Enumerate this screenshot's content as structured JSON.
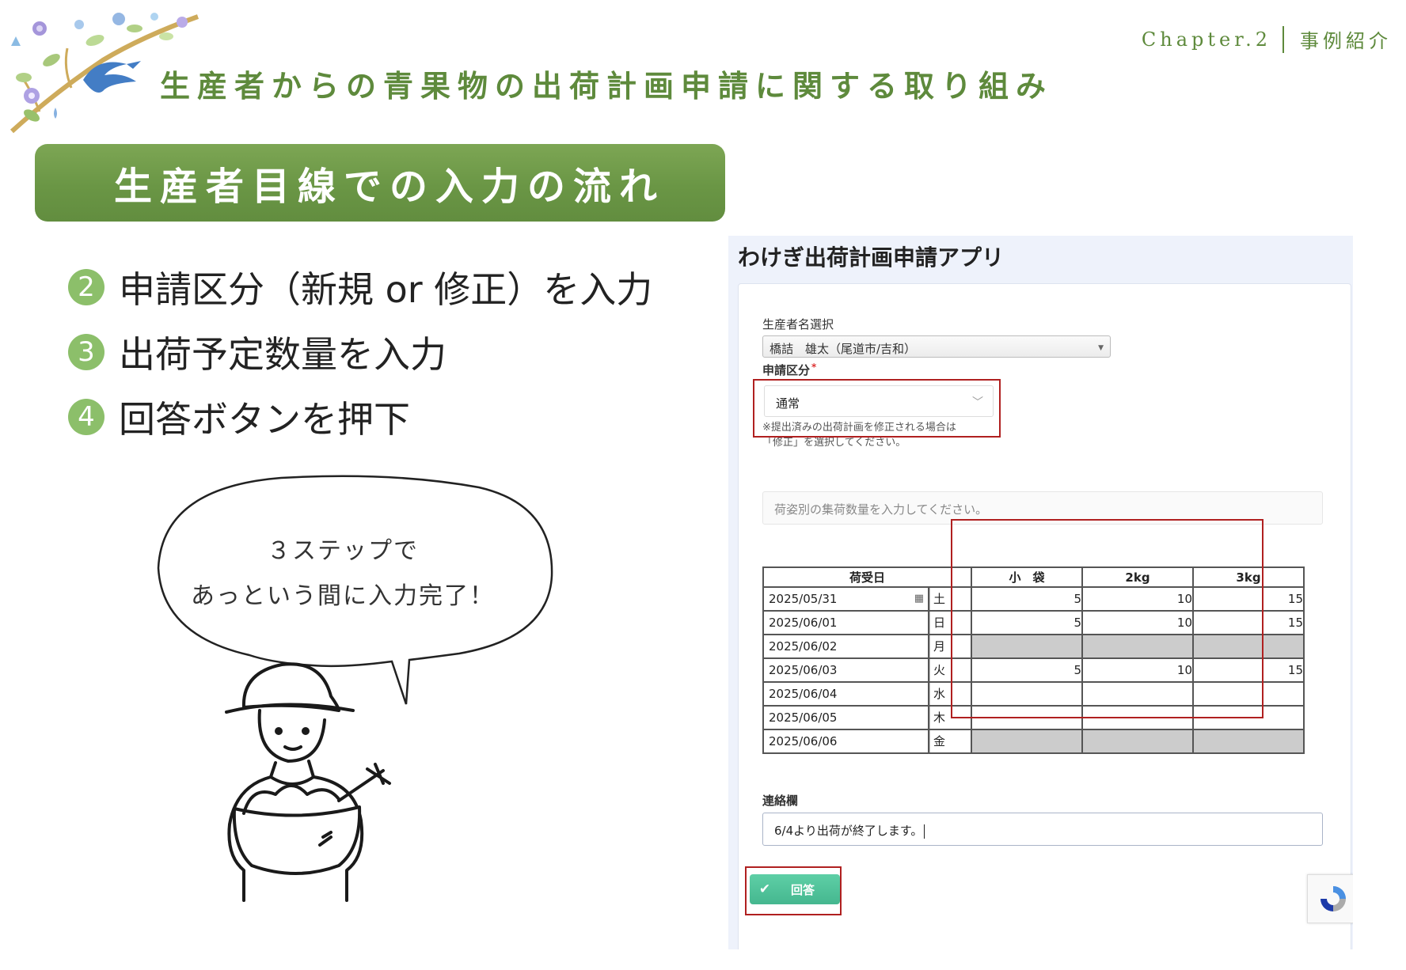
{
  "slide": {
    "chapter": "Chapter.2",
    "section": "事例紹介",
    "title": "生産者からの青果物の出荷計画申請に関する取り組み",
    "banner": "生産者目線での入力の流れ",
    "steps": [
      {
        "num": "2",
        "text": "申請区分（新規 or 修正）を入力"
      },
      {
        "num": "3",
        "text": "出荷予定数量を入力"
      },
      {
        "num": "4",
        "text": "回答ボタンを押下"
      }
    ],
    "bubble": {
      "line1": "３ステップで",
      "line2": "あっという間に入力完了！"
    }
  },
  "app": {
    "title": "わけぎ出荷計画申請アプリ",
    "producer_label": "生産者名選択",
    "producer_value": "橋詰　雄太（尾道市/吉和）",
    "category_label": "申請区分",
    "required_mark": "*",
    "category_value": "通常",
    "category_note_1": "※提出済みの出荷計画を修正される場合は",
    "category_note_2": "「修正」を選択してください。",
    "instruction": "荷姿別の集荷数量を入力してください。",
    "table": {
      "headers": {
        "date": "荷受日",
        "small": "小　袋",
        "kg2": "2kg",
        "kg3": "3kg"
      },
      "rows": [
        {
          "date": "2025/05/31",
          "dow": "土",
          "small": "5",
          "kg2": "10",
          "kg3": "15",
          "disabled": false
        },
        {
          "date": "2025/06/01",
          "dow": "日",
          "small": "5",
          "kg2": "10",
          "kg3": "15",
          "disabled": false
        },
        {
          "date": "2025/06/02",
          "dow": "月",
          "small": "",
          "kg2": "",
          "kg3": "",
          "disabled": true
        },
        {
          "date": "2025/06/03",
          "dow": "火",
          "small": "5",
          "kg2": "10",
          "kg3": "15",
          "disabled": false
        },
        {
          "date": "2025/06/04",
          "dow": "水",
          "small": "",
          "kg2": "",
          "kg3": "",
          "disabled": false
        },
        {
          "date": "2025/06/05",
          "dow": "木",
          "small": "",
          "kg2": "",
          "kg3": "",
          "disabled": false
        },
        {
          "date": "2025/06/06",
          "dow": "金",
          "small": "",
          "kg2": "",
          "kg3": "",
          "disabled": true
        }
      ]
    },
    "memo_label": "連絡欄",
    "memo_value": "6/4より出荷が終了します。",
    "submit_label": "回答",
    "icons": {
      "check": "check-icon",
      "calendar": "calendar-icon",
      "dropdown": "chevron-down-icon",
      "recaptcha": "recaptcha-icon"
    }
  },
  "colors": {
    "accent_green": "#5e8a3c",
    "banner_green": "#6a9645",
    "step_green": "#8cbf6a",
    "highlight_red": "#b02020",
    "submit_green": "#4fc39a"
  }
}
